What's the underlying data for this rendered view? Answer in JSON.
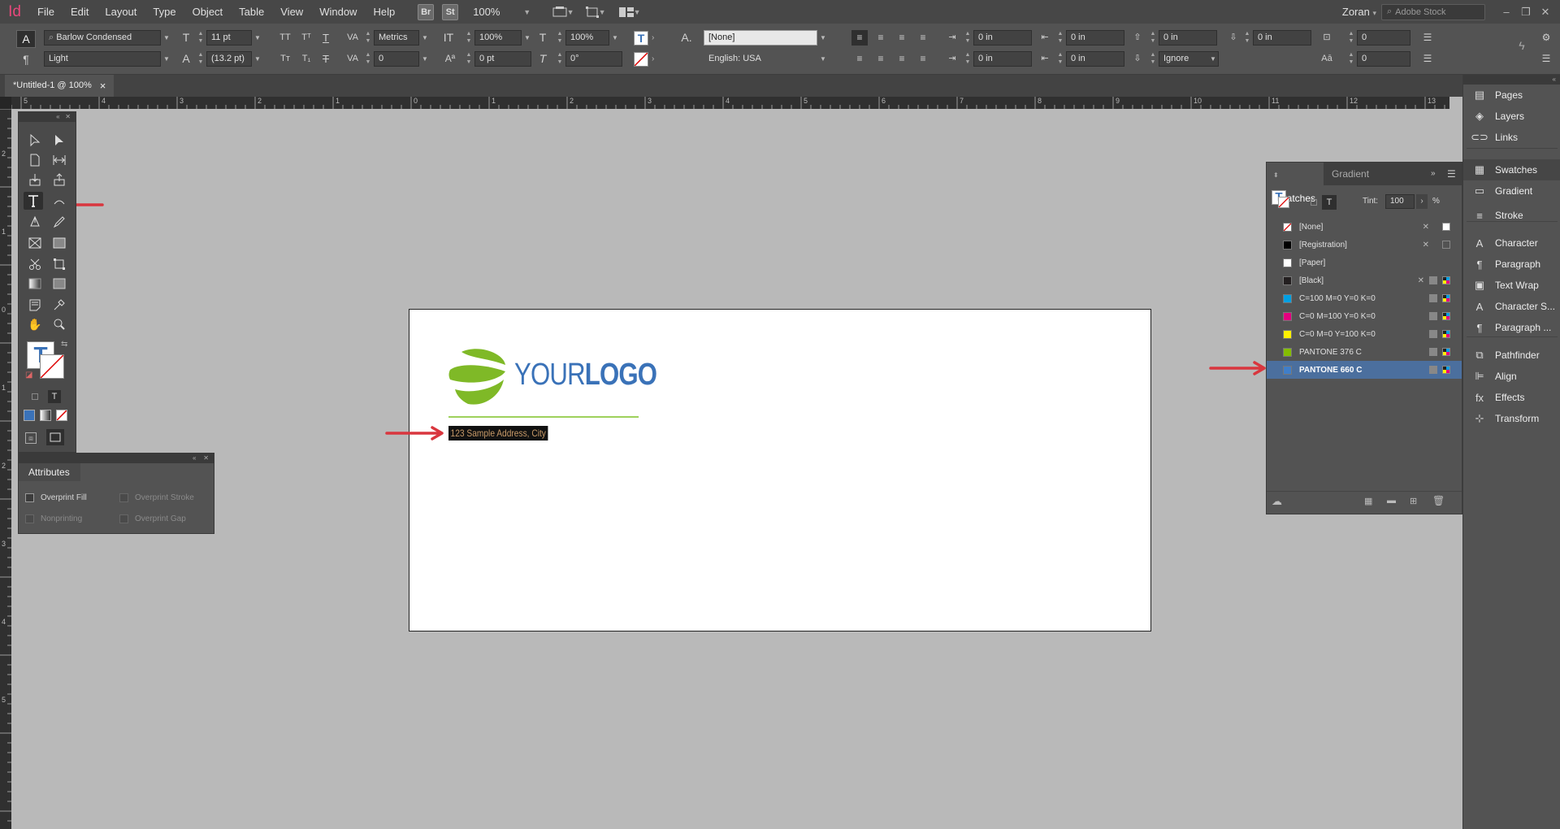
{
  "app": {
    "logo": "Id",
    "accent": "#e7487b"
  },
  "menu": [
    "File",
    "Edit",
    "Layout",
    "Type",
    "Object",
    "Table",
    "View",
    "Window",
    "Help"
  ],
  "menubar": {
    "bridge": "Br",
    "stock": "St",
    "zoom": "100%",
    "user": "Zoran",
    "search_placeholder": "Adobe Stock"
  },
  "control": {
    "font_family": "Barlow Condensed",
    "font_style": "Light",
    "font_size": "11 pt",
    "leading": "(13.2 pt)",
    "kerning": "Metrics",
    "tracking": "0",
    "vertical_scale": "100%",
    "baseline_shift": "0 pt",
    "horizontal_scale": "100%",
    "skew": "0°",
    "char_style": "[None]",
    "language": "English: USA",
    "left_indent": "0 in",
    "first_indent": "0 in",
    "right_indent": "0 in",
    "last_indent": "0 in",
    "space_before": "0 in",
    "space_after": "0 in",
    "drop_cap_lines": "0",
    "drop_cap_chars": "0",
    "hyphenation": "Ignore"
  },
  "document": {
    "tab_title": "*Untitled-1 @ 100%",
    "tab_close": "×",
    "ruler_top": [
      "5",
      "4",
      "3",
      "2",
      "1",
      "0",
      "1",
      "2",
      "3",
      "4",
      "5",
      "6",
      "7",
      "8",
      "9",
      "10",
      "11",
      "12",
      "13"
    ],
    "ruler_left": [
      "2",
      "1",
      "0",
      "1",
      "2",
      "3",
      "4",
      "5"
    ],
    "logo_prefix": "YOUR",
    "logo_bold": "LOGO",
    "address": "123 Sample Address, City",
    "logo_color": "#3a72b8",
    "leaf_color": "#7fb927"
  },
  "attributes": {
    "title": "Attributes",
    "options": [
      {
        "label": "Overprint Fill",
        "enabled": true
      },
      {
        "label": "Overprint Stroke",
        "enabled": false
      },
      {
        "label": "Nonprinting",
        "enabled": false
      },
      {
        "label": "Overprint Gap",
        "enabled": false
      }
    ]
  },
  "swatches": {
    "tabs": [
      "Swatches",
      "Gradient"
    ],
    "tint_label": "Tint:",
    "tint_value": "100",
    "tint_unit": "%",
    "items": [
      {
        "name": "[None]",
        "color": "none"
      },
      {
        "name": "[Registration]",
        "color": "#000000"
      },
      {
        "name": "[Paper]",
        "color": "#ffffff"
      },
      {
        "name": "[Black]",
        "color": "#231f20"
      },
      {
        "name": "C=100 M=0 Y=0 K=0",
        "color": "#00a0e3"
      },
      {
        "name": "C=0 M=100 Y=0 K=0",
        "color": "#e4007f"
      },
      {
        "name": "C=0 M=0 Y=100 K=0",
        "color": "#fff100"
      },
      {
        "name": "PANTONE 376 C",
        "color": "#84bd00"
      },
      {
        "name": "PANTONE 660 C",
        "color": "#407ec9",
        "selected": true
      }
    ]
  },
  "dock": [
    {
      "label": "Pages",
      "icon": "pages-icon"
    },
    {
      "label": "Layers",
      "icon": "layers-icon"
    },
    {
      "label": "Links",
      "icon": "links-icon"
    },
    {
      "label": "Swatches",
      "icon": "swatches-icon",
      "selected": true
    },
    {
      "label": "Gradient",
      "icon": "gradient-icon"
    },
    {
      "label": "Stroke",
      "icon": "stroke-icon"
    },
    {
      "label": "Character",
      "icon": "character-icon"
    },
    {
      "label": "Paragraph",
      "icon": "paragraph-icon"
    },
    {
      "label": "Text Wrap",
      "icon": "text-wrap-icon"
    },
    {
      "label": "Character S...",
      "icon": "character-styles-icon"
    },
    {
      "label": "Paragraph ...",
      "icon": "paragraph-styles-icon"
    },
    {
      "label": "Pathfinder",
      "icon": "pathfinder-icon"
    },
    {
      "label": "Align",
      "icon": "align-icon"
    },
    {
      "label": "Effects",
      "icon": "effects-icon"
    },
    {
      "label": "Transform",
      "icon": "transform-icon"
    }
  ],
  "annotation_color": "#d9363e"
}
